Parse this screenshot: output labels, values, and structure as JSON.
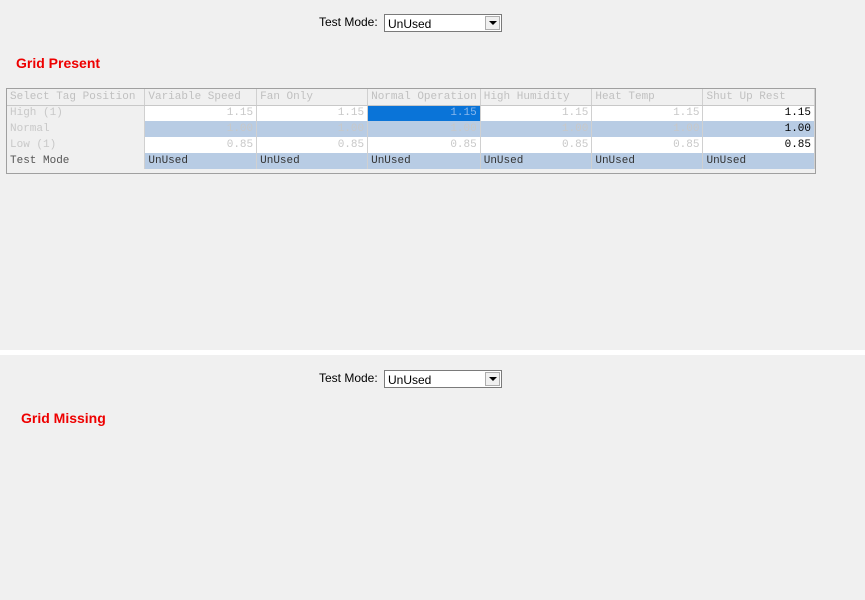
{
  "top_panel": {
    "test_mode_label": "Test Mode:",
    "test_mode_value": "UnUsed",
    "section_title": "Grid Present",
    "grid": {
      "columns": [
        "Select Tag Position",
        "Variable Speed",
        "Fan Only",
        "Normal Operation",
        "High Humidity",
        "Heat Temp",
        "Shut Up Rest"
      ],
      "rows": [
        {
          "label": "High (1)",
          "values": [
            "1.15",
            "1.15",
            "1.15",
            "1.15",
            "1.15",
            "1.15"
          ]
        },
        {
          "label": "Normal",
          "values": [
            "1.00",
            "1.00",
            "1.00",
            "1.00",
            "1.00",
            "1.00"
          ]
        },
        {
          "label": "Low (1)",
          "values": [
            "0.85",
            "0.85",
            "0.85",
            "0.85",
            "0.85",
            "0.85"
          ]
        },
        {
          "label": "Test Mode",
          "values": [
            "UnUsed",
            "UnUsed",
            "UnUsed",
            "UnUsed",
            "UnUsed",
            "UnUsed"
          ]
        }
      ]
    }
  },
  "bottom_panel": {
    "test_mode_label": "Test Mode:",
    "test_mode_value": "UnUsed",
    "section_title": "Grid Missing"
  },
  "colors": {
    "title_red": "#ee0000",
    "alt_row_blue": "#b8cce4",
    "selection_blue": "#0a74d8"
  }
}
